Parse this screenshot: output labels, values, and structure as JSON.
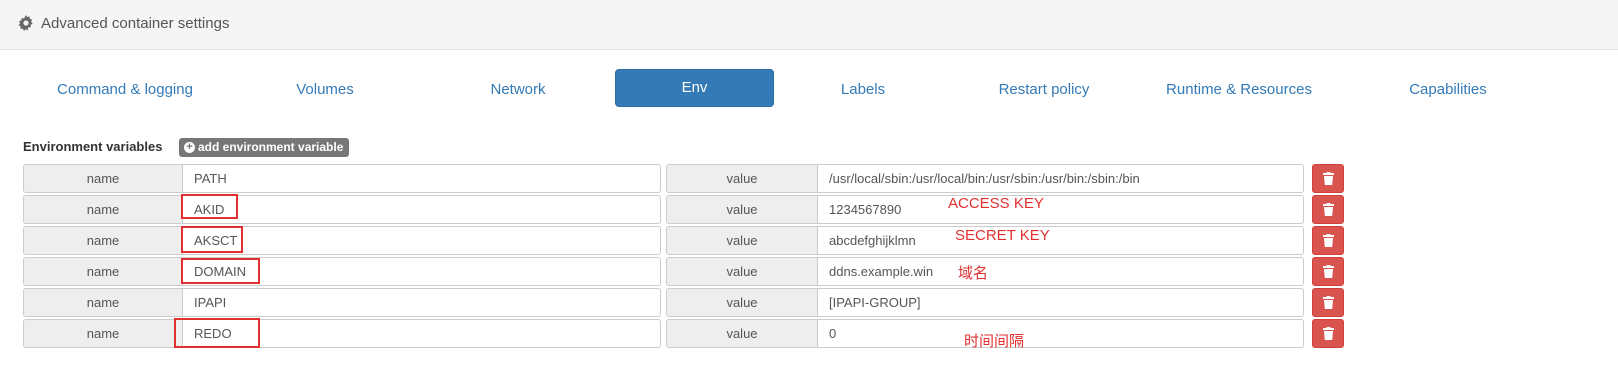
{
  "header": {
    "title": "Advanced container settings",
    "icon": "gear-icon"
  },
  "tabs": [
    {
      "label": "Command & logging",
      "active": false
    },
    {
      "label": "Volumes",
      "active": false
    },
    {
      "label": "Network",
      "active": false
    },
    {
      "label": "Env",
      "active": true
    },
    {
      "label": "Labels",
      "active": false
    },
    {
      "label": "Restart policy",
      "active": false
    },
    {
      "label": "Runtime & Resources",
      "active": false
    },
    {
      "label": "Capabilities",
      "active": false
    }
  ],
  "env": {
    "section_label": "Environment variables",
    "add_button_label": "add environment variable",
    "name_addon": "name",
    "value_addon": "value",
    "rows": [
      {
        "name": "PATH",
        "value": "/usr/local/sbin:/usr/local/bin:/usr/sbin:/usr/bin:/sbin:/bin"
      },
      {
        "name": "AKID",
        "value": "1234567890"
      },
      {
        "name": "AKSCT",
        "value": "abcdefghijklmn"
      },
      {
        "name": "DOMAIN",
        "value": "ddns.example.win"
      },
      {
        "name": "IPAPI",
        "value": "[IPAPI-GROUP]"
      },
      {
        "name": "REDO",
        "value": "0"
      }
    ]
  },
  "annotations": [
    {
      "text": "ACCESS KEY"
    },
    {
      "text": "SECRET KEY"
    },
    {
      "text": "域名"
    },
    {
      "text": "时间间隔"
    }
  ],
  "colors": {
    "primary": "#337ab7",
    "danger": "#d9534f",
    "annotation": "#e23030",
    "addon_bg": "#eeeeee"
  }
}
